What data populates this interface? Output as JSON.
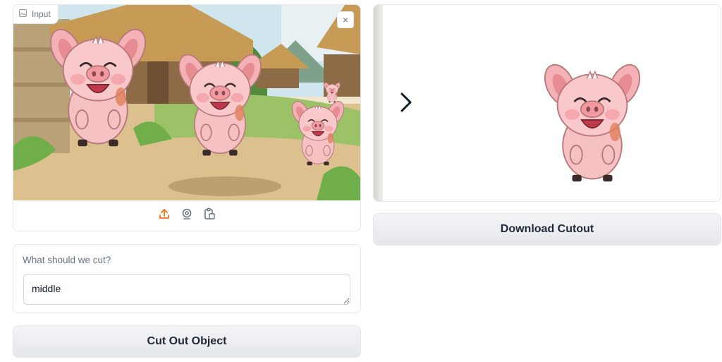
{
  "input_image": {
    "label": "Input",
    "clear_symbol": "×",
    "image_subject": "cartoon pigs in a farm village",
    "sources": [
      {
        "name": "upload",
        "icon": "upload-icon",
        "color": "#f97316"
      },
      {
        "name": "webcam",
        "icon": "webcam-icon",
        "color": "#6b7280"
      },
      {
        "name": "clipboard",
        "icon": "clipboard-icon",
        "color": "#6b7280"
      }
    ]
  },
  "prompt": {
    "label": "What should we cut?",
    "value": "middle"
  },
  "actions": {
    "cut_label": "Cut Out Object",
    "download_label": "Download Cutout"
  },
  "output_image": {
    "image_subject": "cutout of the middle pig on white background",
    "nav_icon": "chevron-right-icon"
  },
  "colors": {
    "accent": "#f97316",
    "border": "#e5e7eb",
    "button_bg": "#e5e7eb",
    "text": "#1f2937"
  }
}
